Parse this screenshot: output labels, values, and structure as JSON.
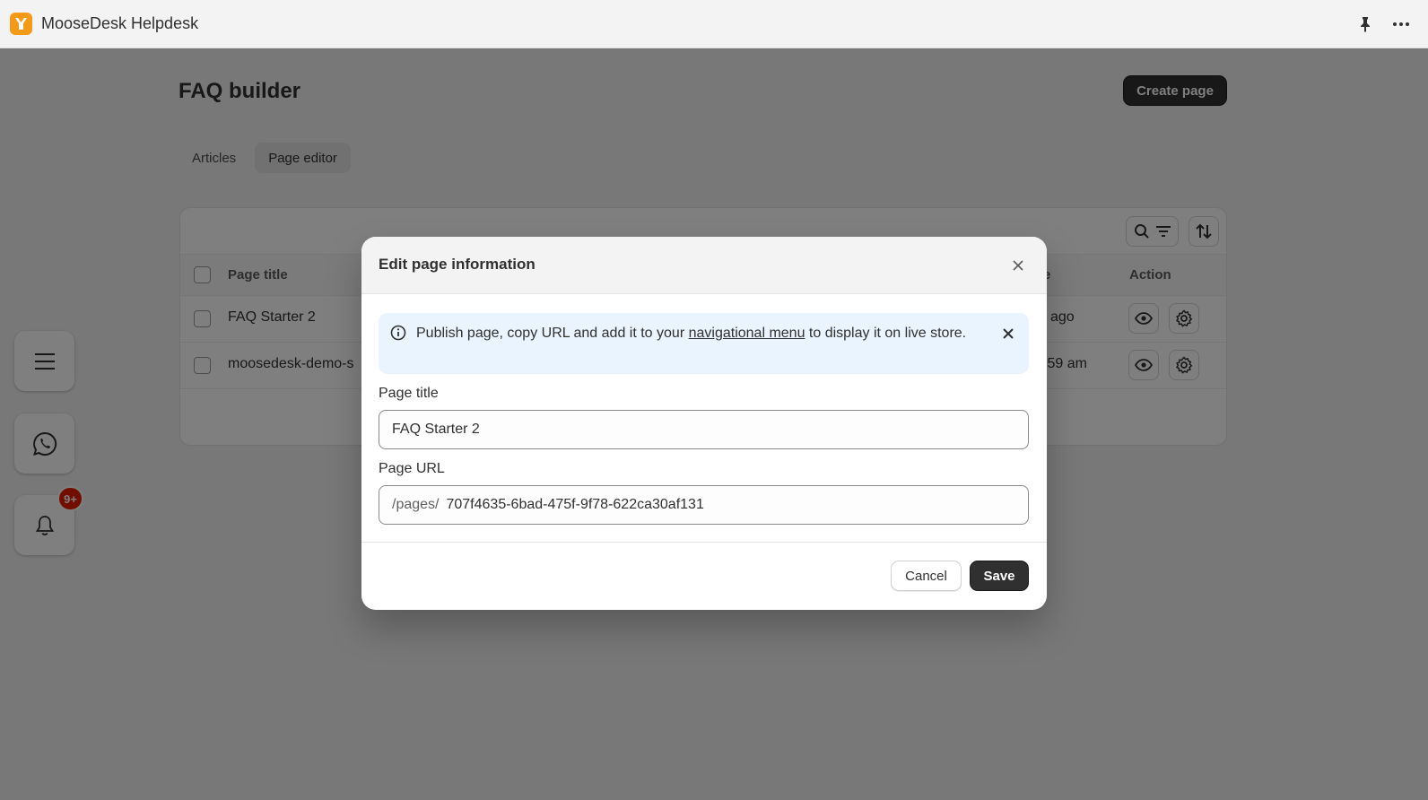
{
  "app": {
    "title": "MooseDesk Helpdesk",
    "accent": "#f49a1a"
  },
  "page": {
    "title": "FAQ builder",
    "create_label": "Create page",
    "tabs": [
      {
        "label": "Articles",
        "active": false
      },
      {
        "label": "Page editor",
        "active": true
      }
    ],
    "table": {
      "headers": {
        "page_title": "Page title",
        "date_partial": "e",
        "action": "Action"
      },
      "rows": [
        {
          "title": "FAQ Starter 2",
          "date_partial": "ago"
        },
        {
          "title": "moosedesk-demo-s",
          "date_partial": ":59 am"
        }
      ]
    }
  },
  "side": {
    "notification_badge": "9+"
  },
  "modal": {
    "title": "Edit page information",
    "banner": {
      "text_before": "Publish page, copy URL and add it to your ",
      "link": "navigational menu",
      "text_after": " to display it on live store."
    },
    "page_title_label": "Page title",
    "page_title_value": "FAQ Starter 2",
    "page_url_label": "Page URL",
    "page_url_prefix": "/pages/",
    "page_url_value": "707f4635-6bad-475f-9f78-622ca30af131",
    "cancel_label": "Cancel",
    "save_label": "Save"
  }
}
